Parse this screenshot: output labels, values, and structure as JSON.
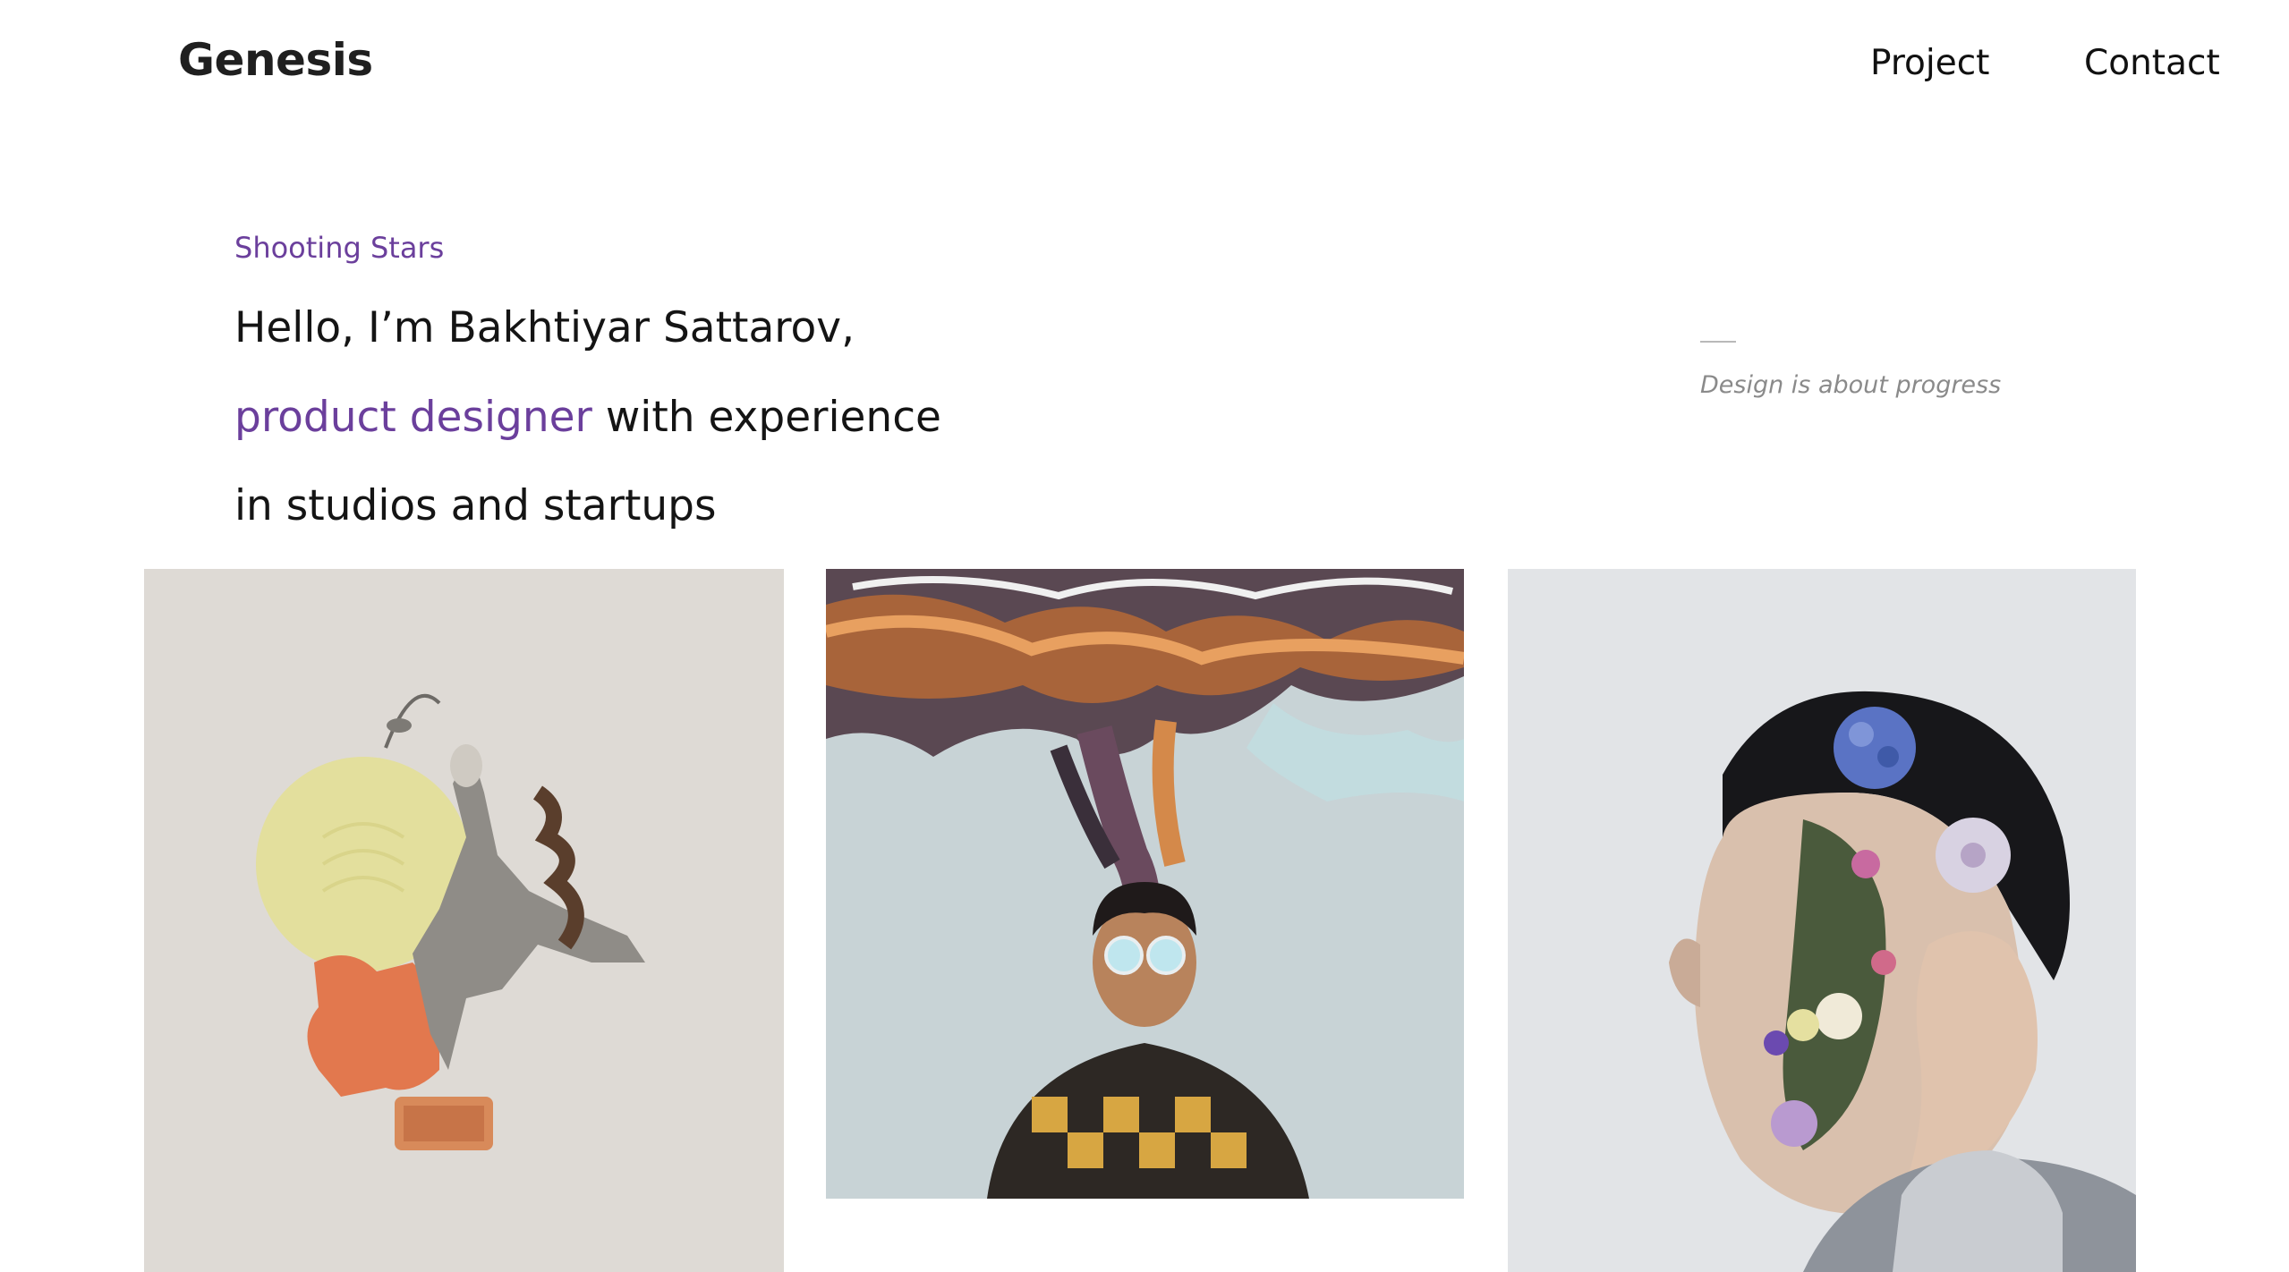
{
  "header": {
    "logo": "Genesis",
    "nav": [
      {
        "label": "Project"
      },
      {
        "label": "Contact"
      }
    ]
  },
  "hero": {
    "eyebrow": "Shooting Stars",
    "line1": "Hello, I’m Bakhtiyar Sattarov,",
    "line2_accent": "product designer",
    "line2_rest": " with experience",
    "line3": "in studios and startups",
    "quote": "Design is about progress"
  },
  "gallery": {
    "items": [
      {
        "subject": "collage-dancer"
      },
      {
        "subject": "man-with-sunglasses-abstract-smoke"
      },
      {
        "subject": "man-with-flowers-face"
      }
    ]
  },
  "colors": {
    "accent": "#6b3f9c",
    "text": "#141414",
    "muted": "#8a8a8a",
    "background": "#ffffff"
  }
}
